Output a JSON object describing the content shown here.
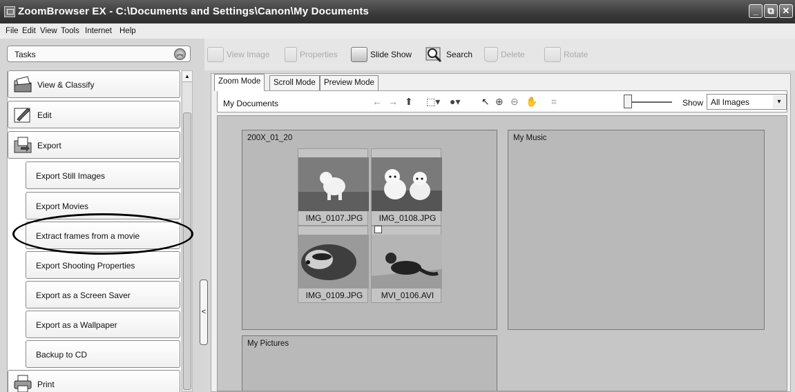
{
  "window": {
    "title": "ZoomBrowser EX  -  C:\\Documents and Settings\\Canon\\My Documents",
    "controls": [
      "_",
      "⧉",
      "✕"
    ]
  },
  "menu": [
    "File",
    "Edit",
    "View",
    "Tools",
    "Internet",
    "Help"
  ],
  "tasks": {
    "header": "Tasks",
    "items": [
      {
        "label": "View & Classify",
        "icon": "folder-view-icon",
        "sub": false
      },
      {
        "label": "Edit",
        "icon": "edit-brush-icon",
        "sub": false
      },
      {
        "label": "Export",
        "icon": "export-icon",
        "sub": false
      },
      {
        "label": "Export Still Images",
        "sub": true
      },
      {
        "label": "Export Movies",
        "sub": true
      },
      {
        "label": "Extract frames from a movie",
        "sub": true,
        "highlighted": true
      },
      {
        "label": "Export Shooting Properties",
        "sub": true
      },
      {
        "label": "Export as a Screen Saver",
        "sub": true
      },
      {
        "label": "Export as a Wallpaper",
        "sub": true
      },
      {
        "label": "Backup to CD",
        "sub": true
      },
      {
        "label": "Print",
        "icon": "printer-icon",
        "sub": false
      }
    ]
  },
  "toolbar": {
    "view_image": "View Image",
    "properties": "Properties",
    "slide_show": "Slide Show",
    "search": "Search",
    "delete": "Delete",
    "rotate": "Rotate"
  },
  "tabs": [
    "Zoom Mode",
    "Scroll Mode",
    "Preview Mode"
  ],
  "viewbar": {
    "location": "My Documents",
    "show_label": "Show",
    "show_value": "All Images"
  },
  "folders": [
    {
      "name": "200X_01_20",
      "images": [
        {
          "file": "IMG_0107.JPG",
          "subject": "dog-photo"
        },
        {
          "file": "IMG_0108.JPG",
          "subject": "two-dogs-photo"
        },
        {
          "file": "IMG_0109.JPG",
          "subject": "ferret-closeup-photo"
        },
        {
          "file": "MVI_0106.AVI",
          "subject": "ferret-movie",
          "movie": true
        }
      ]
    },
    {
      "name": "My Music",
      "images": []
    },
    {
      "name": "My Pictures",
      "images": []
    }
  ],
  "colors": {
    "titlebar": "#3a3a3a",
    "panel": "#d6d6d6",
    "gallery": "#c6c6c6"
  }
}
